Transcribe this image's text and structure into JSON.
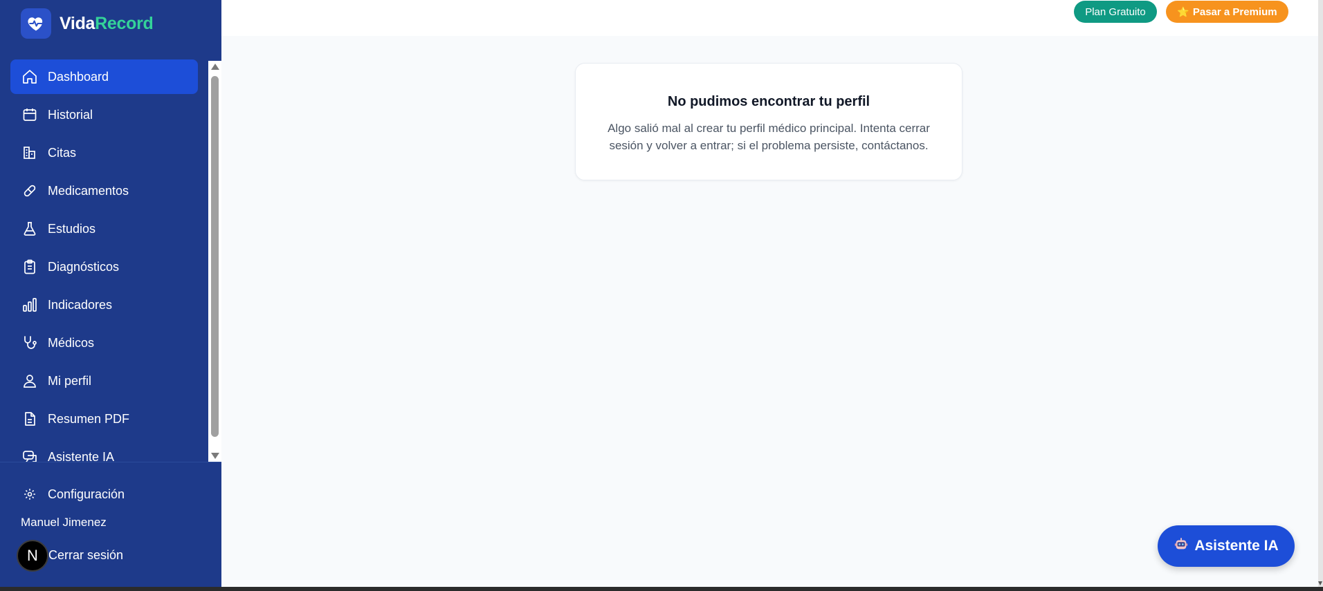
{
  "brand": {
    "name_part1": "Vida",
    "name_part2": "Record"
  },
  "sidebar": {
    "items": [
      {
        "label": "Dashboard",
        "icon": "home-icon",
        "active": true
      },
      {
        "label": "Historial",
        "icon": "calendar-icon"
      },
      {
        "label": "Citas",
        "icon": "building-icon"
      },
      {
        "label": "Medicamentos",
        "icon": "pill-icon"
      },
      {
        "label": "Estudios",
        "icon": "flask-icon"
      },
      {
        "label": "Diagnósticos",
        "icon": "clipboard-icon"
      },
      {
        "label": "Indicadores",
        "icon": "bar-chart-icon"
      },
      {
        "label": "Médicos",
        "icon": "stethoscope-icon"
      },
      {
        "label": "Mi perfil",
        "icon": "user-icon"
      },
      {
        "label": "Resumen PDF",
        "icon": "file-icon"
      },
      {
        "label": "Asistente IA",
        "icon": "chat-icon"
      }
    ],
    "config_label": "Configuración",
    "user_name": "Manuel Jimenez",
    "logout_label": "Cerrar sesión",
    "avatar_letter": "N"
  },
  "topbar": {
    "plan_label": "Plan Gratuito",
    "premium_label": "Pasar a Premium",
    "premium_icon": "⭐"
  },
  "card": {
    "title": "No pudimos encontrar tu perfil",
    "message": "Algo salió mal al crear tu perfil médico principal. Intenta cerrar sesión y volver a entrar; si el problema persiste, contáctanos."
  },
  "fab": {
    "label": "Asistente IA",
    "icon": "robot-icon"
  },
  "colors": {
    "sidebar_bg": "#1e3a8a",
    "active_bg": "#1d4ed8",
    "brand_accent": "#34d399",
    "plan_green": "#0f9a83",
    "premium_orange": "#f7931e"
  }
}
